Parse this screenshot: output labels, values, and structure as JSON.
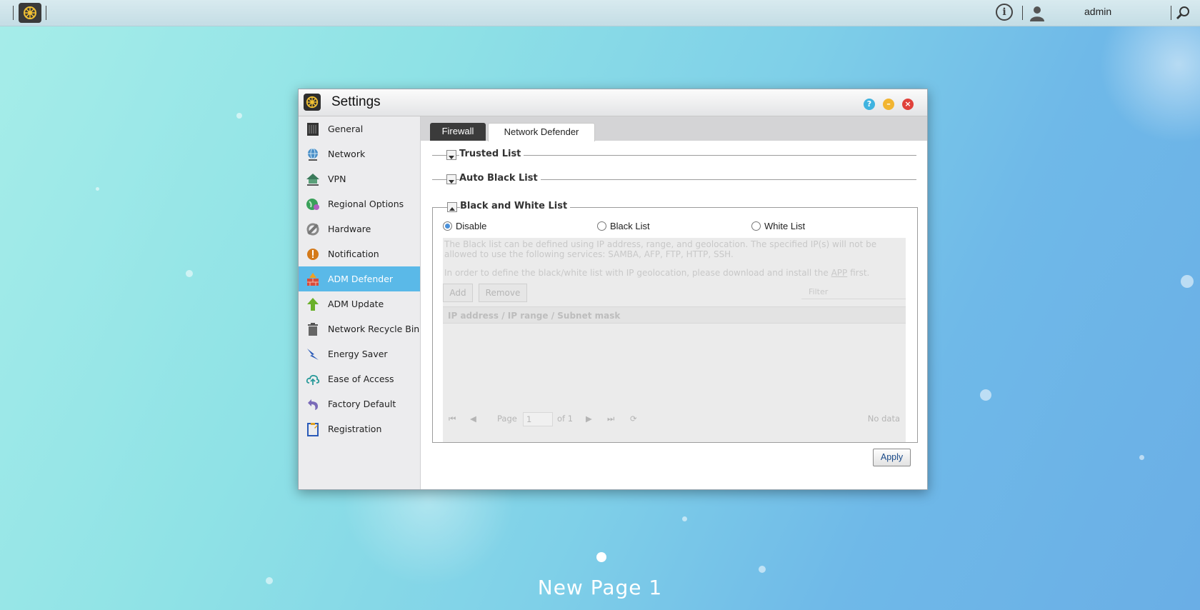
{
  "topbar": {
    "username": "admin"
  },
  "window": {
    "title": "Settings",
    "sidebar": [
      {
        "label": "General",
        "icon": "server-icon"
      },
      {
        "label": "Network",
        "icon": "globe-icon"
      },
      {
        "label": "VPN",
        "icon": "vpn-house-icon"
      },
      {
        "label": "Regional Options",
        "icon": "regional-globe-icon"
      },
      {
        "label": "Hardware",
        "icon": "hardware-icon"
      },
      {
        "label": "Notification",
        "icon": "alert-icon"
      },
      {
        "label": "ADM Defender",
        "icon": "firewall-icon",
        "active": true
      },
      {
        "label": "ADM Update",
        "icon": "up-arrow-icon"
      },
      {
        "label": "Network Recycle Bin",
        "icon": "trash-icon"
      },
      {
        "label": "Energy Saver",
        "icon": "lightning-icon"
      },
      {
        "label": "Ease of Access",
        "icon": "cloud-upload-icon"
      },
      {
        "label": "Factory Default",
        "icon": "undo-icon"
      },
      {
        "label": "Registration",
        "icon": "clipboard-icon"
      }
    ],
    "tabs": {
      "firewall": "Firewall",
      "network_defender": "Network Defender"
    },
    "sections": {
      "trusted": "Trusted List",
      "auto_black": "Auto Black List",
      "black_white": "Black and White List"
    },
    "radios": {
      "disable": "Disable",
      "black": "Black List",
      "white": "White List",
      "selected": "Disable"
    },
    "disabled": {
      "desc1": "The Black list can be defined using IP address, range, and geolocation. The specified IP(s) will not be allowed to use the following services: SAMBA, AFP, FTP, HTTP, SSH.",
      "desc2_pre": "In order to define the black/white list with IP geolocation, please download and install the",
      "desc2_link": "APP",
      "desc2_post": "first.",
      "add": "Add",
      "remove": "Remove",
      "filter_placeholder": "Filter",
      "column": "IP address / IP range / Subnet mask",
      "page_label": "Page",
      "page_value": "1",
      "of_label": "of 1",
      "no_data": "No data"
    },
    "apply": "Apply"
  },
  "desktop": {
    "page_label": "New Page 1"
  },
  "colors": {
    "accent": "#5ab9e8",
    "help": "#3fb3e0",
    "minimize": "#f2b531",
    "close": "#e0413b"
  }
}
